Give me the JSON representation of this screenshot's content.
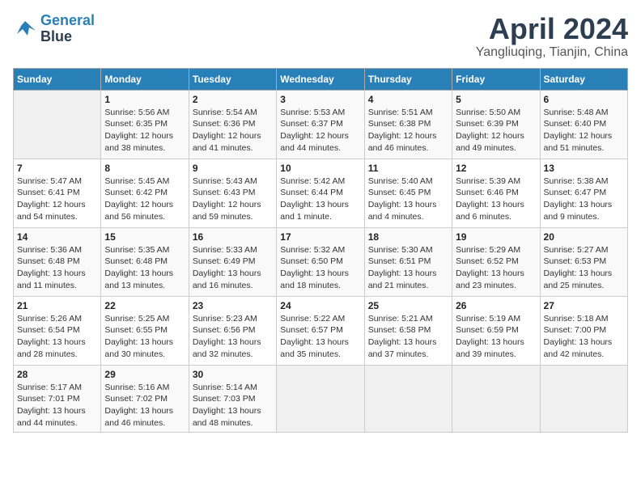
{
  "header": {
    "logo_line1": "General",
    "logo_line2": "Blue",
    "month_title": "April 2024",
    "location": "Yangliuqing, Tianjin, China"
  },
  "weekdays": [
    "Sunday",
    "Monday",
    "Tuesday",
    "Wednesday",
    "Thursday",
    "Friday",
    "Saturday"
  ],
  "weeks": [
    [
      {
        "day": "",
        "sunrise": "",
        "sunset": "",
        "daylight": ""
      },
      {
        "day": "1",
        "sunrise": "Sunrise: 5:56 AM",
        "sunset": "Sunset: 6:35 PM",
        "daylight": "Daylight: 12 hours and 38 minutes."
      },
      {
        "day": "2",
        "sunrise": "Sunrise: 5:54 AM",
        "sunset": "Sunset: 6:36 PM",
        "daylight": "Daylight: 12 hours and 41 minutes."
      },
      {
        "day": "3",
        "sunrise": "Sunrise: 5:53 AM",
        "sunset": "Sunset: 6:37 PM",
        "daylight": "Daylight: 12 hours and 44 minutes."
      },
      {
        "day": "4",
        "sunrise": "Sunrise: 5:51 AM",
        "sunset": "Sunset: 6:38 PM",
        "daylight": "Daylight: 12 hours and 46 minutes."
      },
      {
        "day": "5",
        "sunrise": "Sunrise: 5:50 AM",
        "sunset": "Sunset: 6:39 PM",
        "daylight": "Daylight: 12 hours and 49 minutes."
      },
      {
        "day": "6",
        "sunrise": "Sunrise: 5:48 AM",
        "sunset": "Sunset: 6:40 PM",
        "daylight": "Daylight: 12 hours and 51 minutes."
      }
    ],
    [
      {
        "day": "7",
        "sunrise": "Sunrise: 5:47 AM",
        "sunset": "Sunset: 6:41 PM",
        "daylight": "Daylight: 12 hours and 54 minutes."
      },
      {
        "day": "8",
        "sunrise": "Sunrise: 5:45 AM",
        "sunset": "Sunset: 6:42 PM",
        "daylight": "Daylight: 12 hours and 56 minutes."
      },
      {
        "day": "9",
        "sunrise": "Sunrise: 5:43 AM",
        "sunset": "Sunset: 6:43 PM",
        "daylight": "Daylight: 12 hours and 59 minutes."
      },
      {
        "day": "10",
        "sunrise": "Sunrise: 5:42 AM",
        "sunset": "Sunset: 6:44 PM",
        "daylight": "Daylight: 13 hours and 1 minute."
      },
      {
        "day": "11",
        "sunrise": "Sunrise: 5:40 AM",
        "sunset": "Sunset: 6:45 PM",
        "daylight": "Daylight: 13 hours and 4 minutes."
      },
      {
        "day": "12",
        "sunrise": "Sunrise: 5:39 AM",
        "sunset": "Sunset: 6:46 PM",
        "daylight": "Daylight: 13 hours and 6 minutes."
      },
      {
        "day": "13",
        "sunrise": "Sunrise: 5:38 AM",
        "sunset": "Sunset: 6:47 PM",
        "daylight": "Daylight: 13 hours and 9 minutes."
      }
    ],
    [
      {
        "day": "14",
        "sunrise": "Sunrise: 5:36 AM",
        "sunset": "Sunset: 6:48 PM",
        "daylight": "Daylight: 13 hours and 11 minutes."
      },
      {
        "day": "15",
        "sunrise": "Sunrise: 5:35 AM",
        "sunset": "Sunset: 6:48 PM",
        "daylight": "Daylight: 13 hours and 13 minutes."
      },
      {
        "day": "16",
        "sunrise": "Sunrise: 5:33 AM",
        "sunset": "Sunset: 6:49 PM",
        "daylight": "Daylight: 13 hours and 16 minutes."
      },
      {
        "day": "17",
        "sunrise": "Sunrise: 5:32 AM",
        "sunset": "Sunset: 6:50 PM",
        "daylight": "Daylight: 13 hours and 18 minutes."
      },
      {
        "day": "18",
        "sunrise": "Sunrise: 5:30 AM",
        "sunset": "Sunset: 6:51 PM",
        "daylight": "Daylight: 13 hours and 21 minutes."
      },
      {
        "day": "19",
        "sunrise": "Sunrise: 5:29 AM",
        "sunset": "Sunset: 6:52 PM",
        "daylight": "Daylight: 13 hours and 23 minutes."
      },
      {
        "day": "20",
        "sunrise": "Sunrise: 5:27 AM",
        "sunset": "Sunset: 6:53 PM",
        "daylight": "Daylight: 13 hours and 25 minutes."
      }
    ],
    [
      {
        "day": "21",
        "sunrise": "Sunrise: 5:26 AM",
        "sunset": "Sunset: 6:54 PM",
        "daylight": "Daylight: 13 hours and 28 minutes."
      },
      {
        "day": "22",
        "sunrise": "Sunrise: 5:25 AM",
        "sunset": "Sunset: 6:55 PM",
        "daylight": "Daylight: 13 hours and 30 minutes."
      },
      {
        "day": "23",
        "sunrise": "Sunrise: 5:23 AM",
        "sunset": "Sunset: 6:56 PM",
        "daylight": "Daylight: 13 hours and 32 minutes."
      },
      {
        "day": "24",
        "sunrise": "Sunrise: 5:22 AM",
        "sunset": "Sunset: 6:57 PM",
        "daylight": "Daylight: 13 hours and 35 minutes."
      },
      {
        "day": "25",
        "sunrise": "Sunrise: 5:21 AM",
        "sunset": "Sunset: 6:58 PM",
        "daylight": "Daylight: 13 hours and 37 minutes."
      },
      {
        "day": "26",
        "sunrise": "Sunrise: 5:19 AM",
        "sunset": "Sunset: 6:59 PM",
        "daylight": "Daylight: 13 hours and 39 minutes."
      },
      {
        "day": "27",
        "sunrise": "Sunrise: 5:18 AM",
        "sunset": "Sunset: 7:00 PM",
        "daylight": "Daylight: 13 hours and 42 minutes."
      }
    ],
    [
      {
        "day": "28",
        "sunrise": "Sunrise: 5:17 AM",
        "sunset": "Sunset: 7:01 PM",
        "daylight": "Daylight: 13 hours and 44 minutes."
      },
      {
        "day": "29",
        "sunrise": "Sunrise: 5:16 AM",
        "sunset": "Sunset: 7:02 PM",
        "daylight": "Daylight: 13 hours and 46 minutes."
      },
      {
        "day": "30",
        "sunrise": "Sunrise: 5:14 AM",
        "sunset": "Sunset: 7:03 PM",
        "daylight": "Daylight: 13 hours and 48 minutes."
      },
      {
        "day": "",
        "sunrise": "",
        "sunset": "",
        "daylight": ""
      },
      {
        "day": "",
        "sunrise": "",
        "sunset": "",
        "daylight": ""
      },
      {
        "day": "",
        "sunrise": "",
        "sunset": "",
        "daylight": ""
      },
      {
        "day": "",
        "sunrise": "",
        "sunset": "",
        "daylight": ""
      }
    ]
  ]
}
